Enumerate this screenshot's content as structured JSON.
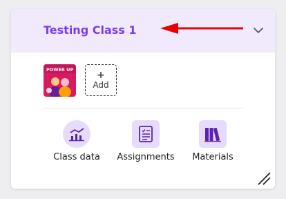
{
  "card": {
    "title": "Testing Class 1",
    "accent_color": "#7c3aed",
    "header_bg": "#f1eafc",
    "arrow_color": "#e60000",
    "expand_icon": "chevron-down-icon"
  },
  "books": [
    {
      "cover_text": "POWER UP",
      "icon": "book-cover-thumbnail"
    }
  ],
  "add_tile": {
    "symbol": "+",
    "label": "Add"
  },
  "actions": [
    {
      "label": "Class data",
      "icon": "bar-chart-icon"
    },
    {
      "label": "Assignments",
      "icon": "clipboard-list-icon"
    },
    {
      "label": "Materials",
      "icon": "books-icon"
    }
  ],
  "footer": {
    "icon": "resize-handle-icon"
  }
}
